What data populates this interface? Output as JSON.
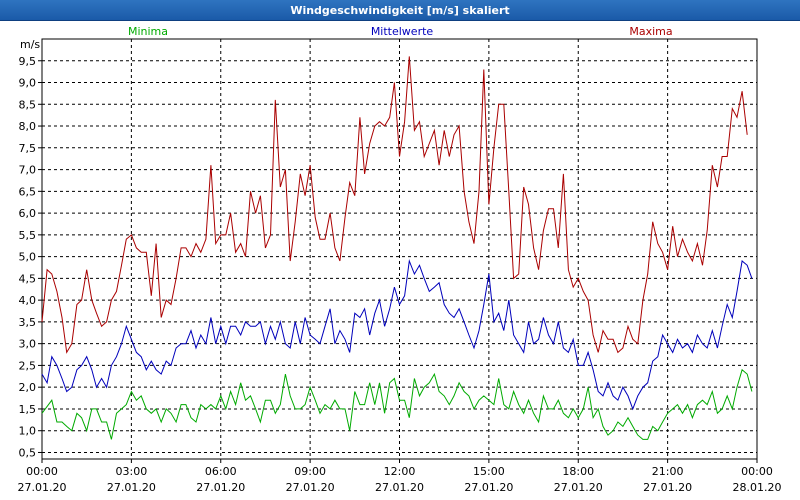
{
  "window": {
    "title": "Windgeschwindigkeit [m/s] skaliert"
  },
  "chart_data": {
    "type": "line",
    "title": "Windgeschwindigkeit [m/s] skaliert",
    "ylabel": "m/s",
    "xlabel": "",
    "ylim": [
      0.35,
      10.0
    ],
    "yticks": [
      "0,5",
      "1,0",
      "1,5",
      "2,0",
      "2,5",
      "3,0",
      "3,5",
      "4,0",
      "4,5",
      "5,0",
      "5,5",
      "6,0",
      "6,5",
      "7,0",
      "7,5",
      "8,0",
      "8,5",
      "9,0",
      "9,5"
    ],
    "ytick_values": [
      0.5,
      1.0,
      1.5,
      2.0,
      2.5,
      3.0,
      3.5,
      4.0,
      4.5,
      5.0,
      5.5,
      6.0,
      6.5,
      7.0,
      7.5,
      8.0,
      8.5,
      9.0,
      9.5
    ],
    "xticks": [
      {
        "time": "00:00",
        "date": "27.01.20"
      },
      {
        "time": "03:00",
        "date": "27.01.20"
      },
      {
        "time": "06:00",
        "date": "27.01.20"
      },
      {
        "time": "09:00",
        "date": "27.01.20"
      },
      {
        "time": "12:00",
        "date": "27.01.20"
      },
      {
        "time": "15:00",
        "date": "27.01.20"
      },
      {
        "time": "18:00",
        "date": "27.01.20"
      },
      {
        "time": "21:00",
        "date": "27.01.20"
      },
      {
        "time": "00:00",
        "date": "28.01.20"
      }
    ],
    "xlim_hours": [
      0,
      24
    ],
    "grid": true,
    "legend": "top",
    "series": [
      {
        "name": "Minima",
        "color": "#00aa00",
        "hours": [
          0,
          0.33,
          0.5,
          0.67,
          0.83,
          1,
          1.17,
          1.33,
          1.5,
          1.67,
          1.83,
          2,
          2.17,
          2.33,
          2.5,
          2.67,
          2.83,
          3,
          3.17,
          3.33,
          3.5,
          3.67,
          3.83,
          4,
          4.17,
          4.33,
          4.5,
          4.67,
          4.83,
          5,
          5.17,
          5.33,
          5.5,
          5.67,
          5.83,
          6,
          6.17,
          6.33,
          6.5,
          6.67,
          6.83,
          7,
          7.17,
          7.33,
          7.5,
          7.67,
          7.83,
          8,
          8.17,
          8.33,
          8.5,
          8.67,
          8.83,
          9,
          9.17,
          9.33,
          9.5,
          9.67,
          9.83,
          10,
          10.17,
          10.33,
          10.5,
          10.67,
          10.83,
          11,
          11.17,
          11.33,
          11.5,
          11.67,
          11.83,
          12,
          12.17,
          12.33,
          12.5,
          12.67,
          12.83,
          13,
          13.17,
          13.33,
          13.5,
          13.67,
          13.83,
          14,
          14.17,
          14.33,
          14.5,
          14.67,
          14.83,
          15,
          15.17,
          15.33,
          15.5,
          15.67,
          15.83,
          16,
          16.17,
          16.33,
          16.5,
          16.67,
          16.83,
          17,
          17.17,
          17.33,
          17.5,
          17.67,
          17.83,
          18,
          18.17,
          18.33,
          18.5,
          18.67,
          18.83,
          19,
          19.17,
          19.33,
          19.5,
          19.67,
          19.83,
          20,
          20.17,
          20.33,
          20.5,
          20.67,
          20.83,
          21,
          21.17,
          21.33,
          21.5,
          21.67,
          21.83,
          22,
          22.17,
          22.33,
          22.5,
          22.67,
          22.83,
          23,
          23.17,
          23.33,
          23.5,
          23.67,
          23.83,
          24
        ],
        "values": [
          1.4,
          1.7,
          1.2,
          1.2,
          1.1,
          1.0,
          1.4,
          1.3,
          1.0,
          1.5,
          1.5,
          1.2,
          1.2,
          0.8,
          1.4,
          1.5,
          1.6,
          1.9,
          1.7,
          1.8,
          1.5,
          1.4,
          1.5,
          1.2,
          1.5,
          1.4,
          1.2,
          1.6,
          1.6,
          1.3,
          1.2,
          1.6,
          1.5,
          1.6,
          1.5,
          1.8,
          1.5,
          1.9,
          1.6,
          2.1,
          1.7,
          1.8,
          1.5,
          1.2,
          1.7,
          1.7,
          1.4,
          1.6,
          2.3,
          1.8,
          1.5,
          1.5,
          1.6,
          2.0,
          1.7,
          1.4,
          1.6,
          1.5,
          1.7,
          1.5,
          1.5,
          1.0,
          1.9,
          1.6,
          1.6,
          2.1,
          1.6,
          2.1,
          1.4,
          2.1,
          2.2,
          1.7,
          1.7,
          1.3,
          2.2,
          1.8,
          2.0,
          2.1,
          2.3,
          1.9,
          1.8,
          1.6,
          1.8,
          2.1,
          1.9,
          1.8,
          1.5,
          1.7,
          1.8,
          1.7,
          1.6,
          2.2,
          1.6,
          1.5,
          1.9,
          1.6,
          1.4,
          1.7,
          1.4,
          1.2,
          1.8,
          1.5,
          1.5,
          1.7,
          1.4,
          1.3,
          1.5,
          1.3,
          1.5,
          2.0,
          1.3,
          1.5,
          1.1,
          0.9,
          1.0,
          1.2,
          1.1,
          1.3,
          1.1,
          0.9,
          0.8,
          0.8,
          1.1,
          1.0,
          1.2,
          1.4,
          1.5,
          1.6,
          1.4,
          1.6,
          1.3,
          1.6,
          1.7,
          1.6,
          1.9,
          1.4,
          1.5,
          1.8,
          1.5,
          2.0,
          2.4,
          2.3,
          1.9
        ]
      },
      {
        "name": "Mittelwerte",
        "color": "#0000bb",
        "hours": [
          0,
          0.17,
          0.33,
          0.5,
          0.67,
          0.83,
          1,
          1.17,
          1.33,
          1.5,
          1.67,
          1.83,
          2,
          2.17,
          2.33,
          2.5,
          2.67,
          2.83,
          3,
          3.17,
          3.33,
          3.5,
          3.67,
          3.83,
          4,
          4.17,
          4.33,
          4.5,
          4.67,
          4.83,
          5,
          5.17,
          5.33,
          5.5,
          5.67,
          5.83,
          6,
          6.17,
          6.33,
          6.5,
          6.67,
          6.83,
          7,
          7.17,
          7.33,
          7.5,
          7.67,
          7.83,
          8,
          8.17,
          8.33,
          8.5,
          8.67,
          8.83,
          9,
          9.17,
          9.33,
          9.5,
          9.67,
          9.83,
          10,
          10.17,
          10.33,
          10.5,
          10.67,
          10.83,
          11,
          11.17,
          11.33,
          11.5,
          11.67,
          11.83,
          12,
          12.17,
          12.33,
          12.5,
          12.67,
          12.83,
          13,
          13.17,
          13.33,
          13.5,
          13.67,
          13.83,
          14,
          14.17,
          14.33,
          14.5,
          14.67,
          14.83,
          15,
          15.17,
          15.33,
          15.5,
          15.67,
          15.83,
          16,
          16.17,
          16.33,
          16.5,
          16.67,
          16.83,
          17,
          17.17,
          17.33,
          17.5,
          17.67,
          17.83,
          18,
          18.17,
          18.33,
          18.5,
          18.67,
          18.83,
          19,
          19.17,
          19.33,
          19.5,
          19.67,
          19.83,
          20,
          20.17,
          20.33,
          20.5,
          20.67,
          20.83,
          21,
          21.17,
          21.33,
          21.5,
          21.67,
          21.83,
          22,
          22.17,
          22.33,
          22.5,
          22.67,
          22.83,
          23,
          23.17,
          23.33,
          23.5,
          23.67,
          23.83,
          24
        ],
        "values": [
          2.3,
          2.1,
          2.7,
          2.5,
          2.2,
          1.9,
          2.0,
          2.4,
          2.5,
          2.7,
          2.4,
          2.0,
          2.2,
          2.0,
          2.5,
          2.7,
          3.0,
          3.4,
          3.1,
          2.8,
          2.7,
          2.4,
          2.6,
          2.4,
          2.3,
          2.6,
          2.5,
          2.9,
          3.0,
          3.0,
          3.3,
          2.9,
          3.2,
          3.0,
          3.6,
          3.0,
          3.4,
          3.0,
          3.4,
          3.4,
          3.2,
          3.5,
          3.4,
          3.4,
          3.5,
          3.0,
          3.4,
          3.1,
          3.5,
          3.0,
          2.9,
          3.5,
          3.0,
          3.6,
          3.2,
          3.1,
          3.0,
          3.4,
          3.8,
          3.0,
          3.3,
          3.1,
          2.8,
          3.7,
          3.6,
          3.8,
          3.2,
          3.7,
          4.0,
          3.4,
          3.8,
          4.3,
          3.9,
          4.1,
          4.9,
          4.6,
          4.8,
          4.5,
          4.2,
          4.3,
          4.4,
          3.9,
          3.7,
          3.6,
          3.8,
          3.5,
          3.2,
          2.9,
          3.3,
          3.9,
          4.6,
          3.5,
          3.7,
          3.3,
          4.0,
          3.2,
          3.0,
          2.8,
          3.5,
          3.0,
          3.1,
          3.6,
          3.2,
          3.0,
          3.5,
          2.9,
          2.8,
          3.1,
          2.5,
          2.5,
          2.8,
          2.4,
          1.9,
          1.8,
          2.1,
          1.8,
          1.7,
          2.0,
          1.8,
          1.5,
          1.8,
          2.0,
          2.1,
          2.6,
          2.7,
          3.2,
          3.0,
          2.8,
          3.1,
          2.9,
          3.0,
          2.8,
          3.2,
          3.0,
          2.9,
          3.3,
          2.9,
          3.4,
          3.9,
          3.6,
          4.2,
          4.9,
          4.8,
          4.5
        ]
      },
      {
        "name": "Maxima",
        "color": "#aa0000",
        "hours": [
          0,
          0.17,
          0.33,
          0.5,
          0.67,
          0.83,
          1,
          1.17,
          1.33,
          1.5,
          1.67,
          1.83,
          2,
          2.17,
          2.33,
          2.5,
          2.67,
          2.83,
          3,
          3.17,
          3.33,
          3.5,
          3.67,
          3.83,
          4,
          4.17,
          4.33,
          4.5,
          4.67,
          4.83,
          5,
          5.17,
          5.33,
          5.5,
          5.67,
          5.83,
          6,
          6.17,
          6.33,
          6.5,
          6.67,
          6.83,
          7,
          7.17,
          7.33,
          7.5,
          7.67,
          7.83,
          8,
          8.17,
          8.33,
          8.5,
          8.67,
          8.83,
          9,
          9.17,
          9.33,
          9.5,
          9.67,
          9.83,
          10,
          10.17,
          10.33,
          10.5,
          10.67,
          10.83,
          11,
          11.17,
          11.33,
          11.5,
          11.67,
          11.83,
          12,
          12.17,
          12.33,
          12.5,
          12.67,
          12.83,
          13,
          13.17,
          13.33,
          13.5,
          13.67,
          13.83,
          14,
          14.17,
          14.33,
          14.5,
          14.67,
          14.83,
          15,
          15.17,
          15.33,
          15.5,
          15.67,
          15.83,
          16,
          16.17,
          16.33,
          16.5,
          16.67,
          16.83,
          17,
          17.17,
          17.33,
          17.5,
          17.67,
          17.83,
          18,
          18.17,
          18.33,
          18.5,
          18.67,
          18.83,
          19,
          19.17,
          19.33,
          19.5,
          19.67,
          19.83,
          20,
          20.17,
          20.33,
          20.5,
          20.67,
          20.83,
          21,
          21.17,
          21.33,
          21.5,
          21.67,
          21.83,
          22,
          22.17,
          22.33,
          22.5,
          22.67,
          22.83,
          23,
          23.17,
          23.33,
          23.5,
          23.67,
          23.83,
          24
        ],
        "values": [
          3.5,
          4.7,
          4.6,
          4.2,
          3.6,
          2.8,
          3.0,
          3.9,
          4.0,
          4.7,
          4.0,
          3.7,
          3.4,
          3.5,
          4.0,
          4.2,
          4.8,
          5.4,
          5.5,
          5.2,
          5.1,
          5.1,
          4.1,
          5.3,
          3.6,
          4.0,
          3.9,
          4.5,
          5.2,
          5.2,
          5.0,
          5.3,
          5.1,
          5.4,
          7.1,
          5.3,
          5.5,
          5.5,
          6.0,
          5.1,
          5.3,
          5.0,
          6.5,
          6.0,
          6.4,
          5.2,
          5.5,
          8.6,
          6.6,
          7.0,
          4.9,
          5.8,
          6.9,
          6.4,
          7.1,
          5.9,
          5.4,
          5.4,
          6.0,
          5.2,
          4.9,
          5.9,
          6.7,
          6.4,
          8.2,
          6.9,
          7.6,
          8.0,
          8.1,
          8.0,
          8.2,
          9.0,
          7.3,
          8.1,
          9.6,
          7.9,
          8.1,
          7.3,
          7.6,
          7.9,
          7.1,
          7.9,
          7.3,
          7.8,
          8.0,
          6.5,
          5.8,
          5.3,
          6.5,
          9.3,
          6.2,
          7.5,
          8.5,
          8.5,
          6.5,
          4.5,
          4.6,
          6.6,
          6.2,
          5.2,
          4.7,
          5.6,
          6.1,
          6.1,
          5.2,
          6.9,
          4.7,
          4.3,
          4.5,
          4.2,
          4.0,
          3.2,
          2.8,
          3.3,
          3.1,
          3.1,
          2.8,
          2.9,
          3.4,
          3.1,
          3.0,
          4.0,
          4.6,
          5.8,
          5.3,
          5.1,
          4.7,
          5.7,
          5.0,
          5.4,
          5.1,
          4.9,
          5.3,
          4.8,
          5.6,
          7.1,
          6.6,
          7.3,
          7.3,
          8.4,
          8.2,
          8.8,
          7.8
        ]
      }
    ]
  }
}
